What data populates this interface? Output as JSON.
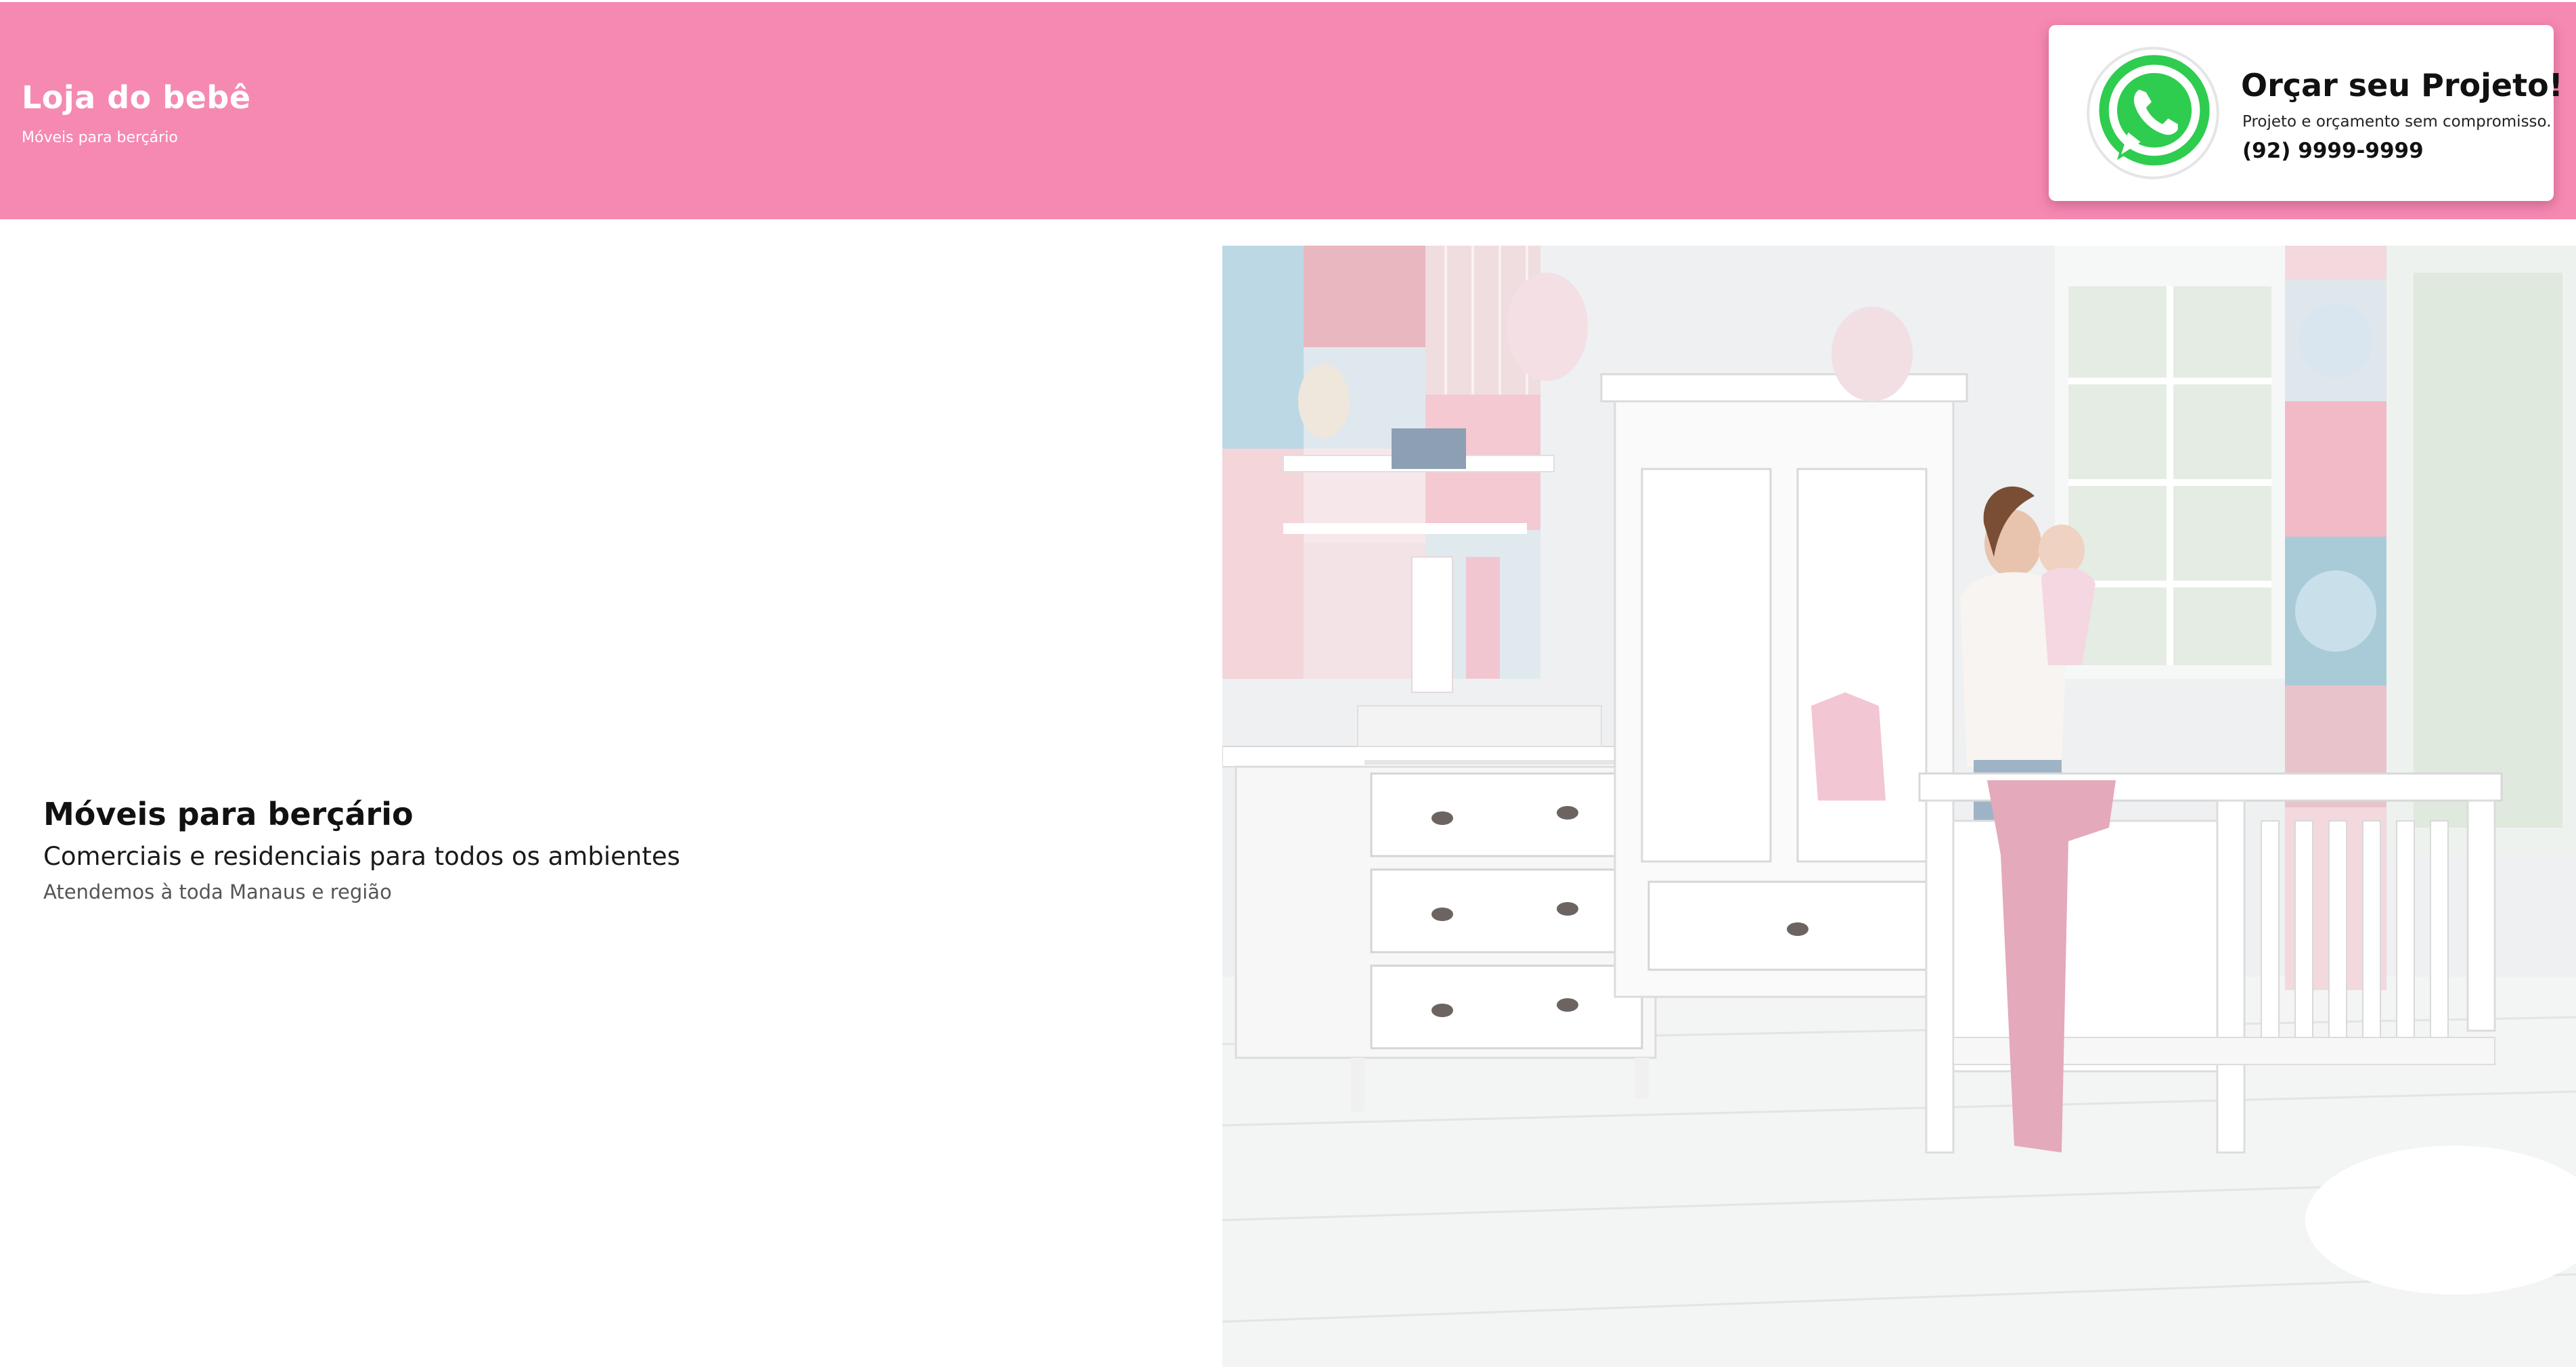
{
  "header": {
    "brand_title": "Loja do bebê",
    "brand_subtitle": "Móveis para berçário",
    "background_color": "#f589b2"
  },
  "cta": {
    "icon": "whatsapp-icon",
    "title": "Orçar seu Projeto!",
    "subtitle": "Projeto e orçamento sem compromisso.",
    "phone": "(92) 9999-9999",
    "icon_color": "#2ecc4f"
  },
  "hero": {
    "title": "Móveis para berçário",
    "subtitle": "Comerciais e residenciais para todos os ambientes",
    "region": "Atendemos à toda Manaus e região",
    "image": "nursery-room-photo"
  }
}
